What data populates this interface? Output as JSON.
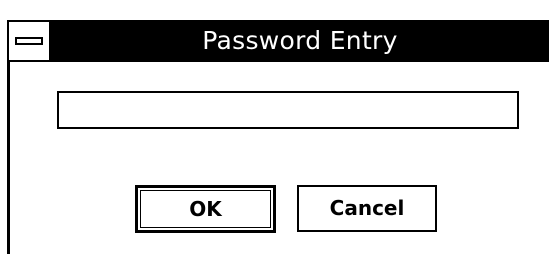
{
  "window": {
    "title": "Password Entry"
  },
  "password_field": {
    "value": ""
  },
  "buttons": {
    "ok_label": "OK",
    "cancel_label": "Cancel"
  },
  "colors": {
    "titlebar": "#000000",
    "title_text": "#ffffff",
    "background": "#ffffff"
  },
  "icons": {
    "system_menu": "system-menu-icon"
  }
}
